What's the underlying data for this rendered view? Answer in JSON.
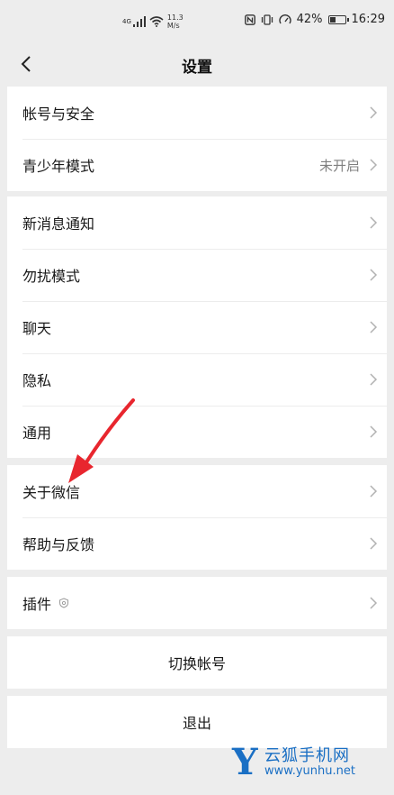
{
  "status_bar": {
    "network": "4G",
    "speed_value": "11.3",
    "speed_unit": "M/s",
    "battery": "42%",
    "battery_level": 0.42,
    "time": "16:29"
  },
  "nav": {
    "title": "设置",
    "back_icon": "chevron-left-icon"
  },
  "groups": {
    "account": [
      {
        "label": "帐号与安全"
      },
      {
        "label": "青少年模式",
        "value": "未开启"
      }
    ],
    "prefs": [
      {
        "label": "新消息通知"
      },
      {
        "label": "勿扰模式"
      },
      {
        "label": "聊天"
      },
      {
        "label": "隐私"
      },
      {
        "label": "通用"
      }
    ],
    "about": [
      {
        "label": "关于微信"
      },
      {
        "label": "帮助与反馈"
      }
    ],
    "plugins": [
      {
        "label": "插件",
        "icon": "shield-badge-icon"
      }
    ]
  },
  "actions": {
    "switch_account": "切换帐号",
    "logout": "退出"
  },
  "watermark": {
    "letter": "Y",
    "name": "云狐手机网",
    "url": "www.yunhu.net",
    "color": "#1a6fc4"
  },
  "annotation": {
    "type": "red-arrow",
    "target": "关于微信",
    "color": "#e8262e"
  }
}
